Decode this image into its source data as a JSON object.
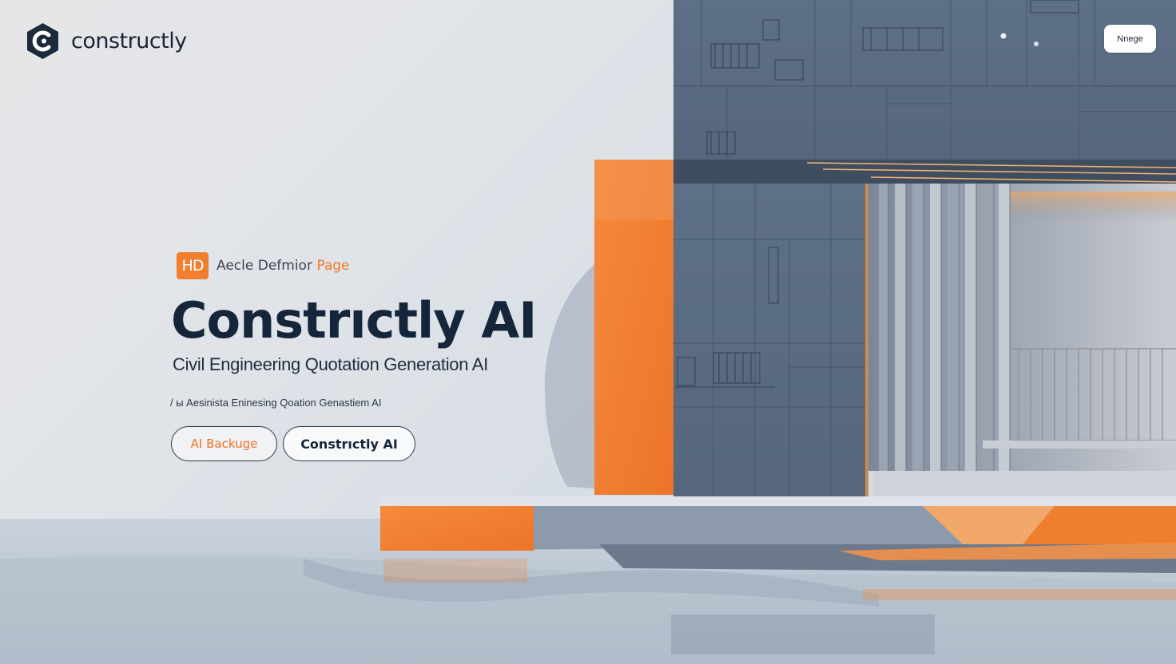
{
  "brand": {
    "name": "constructly",
    "accent_color": "#f08030",
    "dark_color": "#15263a"
  },
  "header": {
    "top_right_button_label": "Nnege"
  },
  "hero": {
    "badge_icon_text": "HD",
    "badge_label_main": "Aecle Defmior ",
    "badge_label_accent": "Page",
    "title": "Constrıctly AI",
    "subtitle": "Civil Engineering Quotation Generation AI",
    "caption": "/ ы Aesinista Eninesing Qoation Genastiem AI",
    "secondary_cta_label": "AI Backuge",
    "primary_cta_label": "Constrıctly AI"
  },
  "icons": {
    "logo": "constructly-logo-icon"
  }
}
